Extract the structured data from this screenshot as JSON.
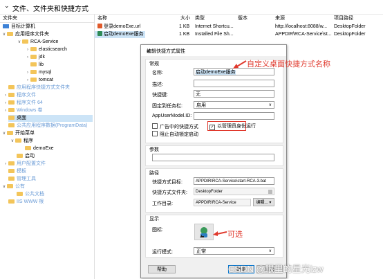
{
  "header": {
    "title": "文件、文件夹和快捷方式"
  },
  "tree": {
    "header": "文件夹",
    "nodes": [
      {
        "label": "目标计算机",
        "icon": "computer-icon"
      },
      {
        "label": "应用程序文件夹",
        "icon": "folder-icon"
      },
      {
        "label": "RCA-Service",
        "icon": "folder-icon"
      },
      {
        "label": "elasticsearch",
        "icon": "folder-icon"
      },
      {
        "label": "jdk",
        "icon": "folder-icon"
      },
      {
        "label": "lib",
        "icon": "folder-icon"
      },
      {
        "label": "mysql",
        "icon": "folder-icon"
      },
      {
        "label": "tomcat",
        "icon": "folder-icon"
      },
      {
        "label": "应用程序快捷方式文件夹",
        "icon": "folder-icon"
      },
      {
        "label": "程序文件",
        "icon": "folder-icon"
      },
      {
        "label": "程序文件 64",
        "icon": "folder-icon"
      },
      {
        "label": "Windows 卷",
        "icon": "folder-icon"
      },
      {
        "label": "桌面",
        "icon": "folder-icon"
      },
      {
        "label": "公共应用程序数据(ProgramData)",
        "icon": "folder-icon"
      },
      {
        "label": "开始菜单",
        "icon": "folder-icon"
      },
      {
        "label": "程序",
        "icon": "folder-icon"
      },
      {
        "label": "demoExe",
        "icon": "folder-icon"
      },
      {
        "label": "启动",
        "icon": "folder-icon"
      },
      {
        "label": "用户配置文件",
        "icon": "folder-icon"
      },
      {
        "label": "模板",
        "icon": "folder-icon"
      },
      {
        "label": "管理工具",
        "icon": "folder-icon"
      },
      {
        "label": "公有",
        "icon": "folder-icon"
      },
      {
        "label": "公共文档",
        "icon": "folder-icon"
      },
      {
        "label": "IIS WWW 根",
        "icon": "folder-icon"
      }
    ]
  },
  "list": {
    "columns": [
      "名称",
      "大小",
      "类型",
      "版本",
      "来源",
      "项目路径"
    ],
    "rows": [
      {
        "name": "登录demoExe.url",
        "size": "1 KB",
        "type": "Internet Shortcu...",
        "version": "",
        "source": "http://localhost:8088/w...",
        "path": "DesktopFolder"
      },
      {
        "name": "启动demoExe服务",
        "size": "1 KB",
        "type": "Installed File Sh...",
        "version": "",
        "source": "APPDIR\\RCA-Service\\st...",
        "path": "DesktopFolder"
      }
    ]
  },
  "dialog": {
    "title": "编辑快捷方式属性",
    "close": "×",
    "general_label": "常规",
    "name_label": "名称:",
    "name_value": "启动demoExe服务",
    "desc_label": "描述:",
    "desc_value": "",
    "hotkey_label": "快捷键:",
    "hotkey_value": "无",
    "pin_label": "固定到任务栏:",
    "pin_value": "启用",
    "appid_label": "AppUserModel.ID:",
    "appid_value": "",
    "ad_checkbox": "广告中的快捷方式",
    "admin_checkbox": "以管理员身份运行",
    "block_checkbox": "阻止自动锁定启动",
    "params_label": "参数",
    "params_value": "",
    "path_label": "路径",
    "target_label": "快捷方式目标:",
    "target_value": "APPDIR\\RCA-Service\\start-RCA-3.bat",
    "folder_label": "快捷方式文件夹:",
    "folder_value": "DesktopFolder",
    "workdir_label": "工作目录:",
    "workdir_value": "APPDIR\\RCA-Service",
    "edit_button": "编辑...",
    "display_label": "显示",
    "icon_label": "图标:",
    "runmode_label": "运行模式:",
    "runmode_value": "正常",
    "help_button": "帮助",
    "ok_button": "确定",
    "cancel_button": "取消"
  },
  "annotations": {
    "custom_name": "自定义桌面快捷方式名称",
    "optional": "可选"
  },
  "watermark": "CSDN @眼里的星光lzw",
  "colors": {
    "annotation": "#e0392d",
    "selection": "#cce4f7"
  }
}
